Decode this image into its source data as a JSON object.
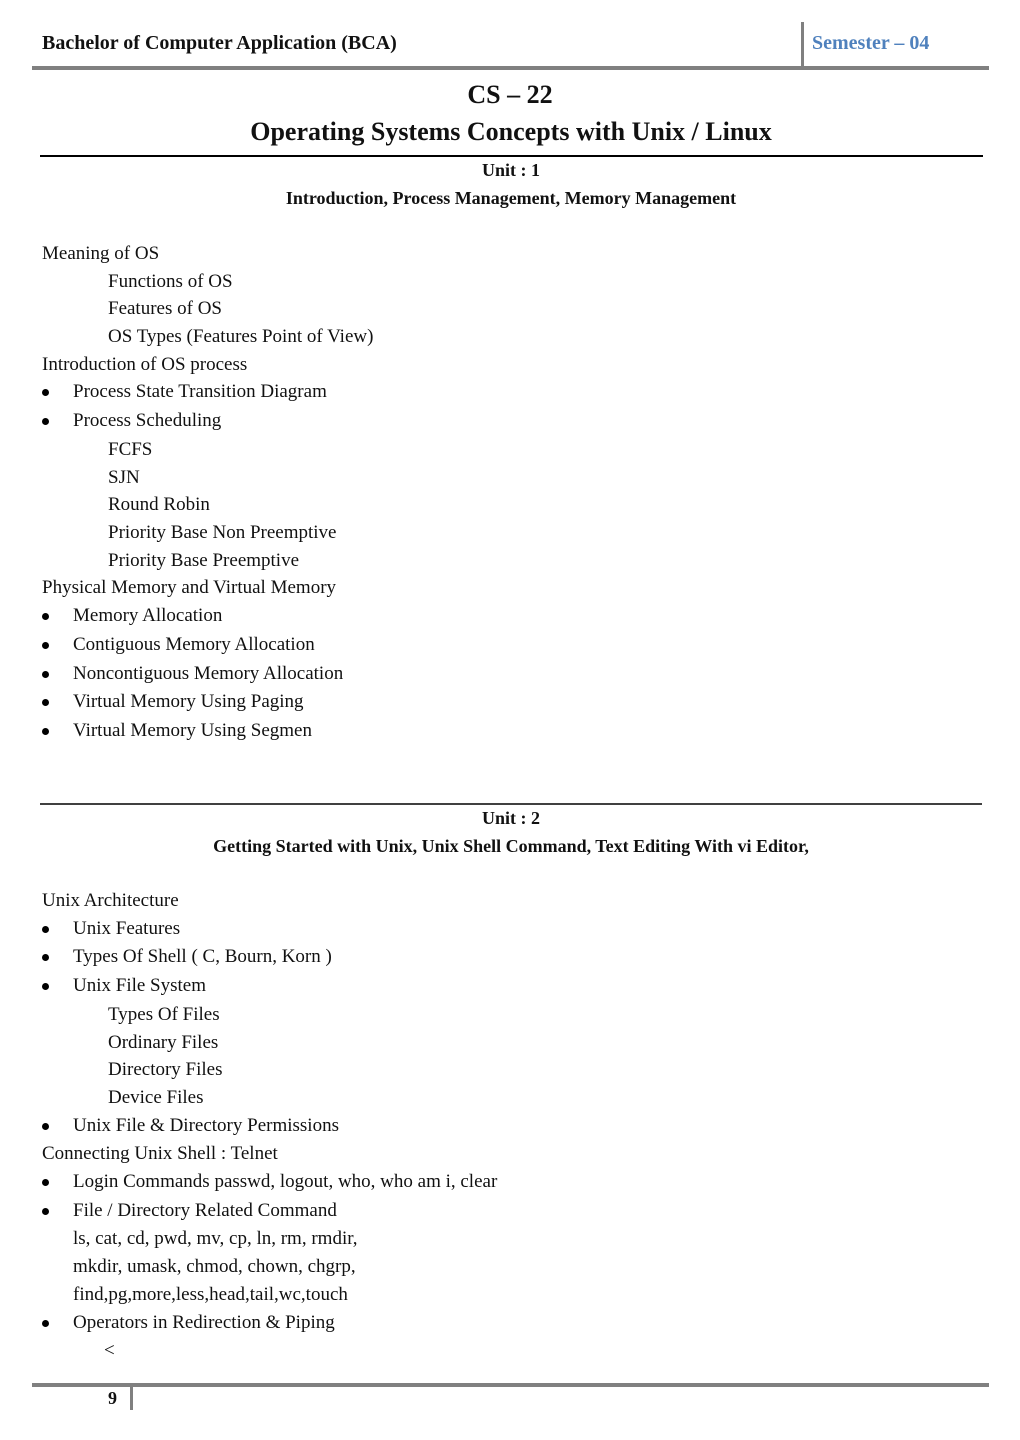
{
  "header": {
    "program": "Bachelor of Computer Application (BCA)",
    "semester": "Semester – 04",
    "semester_color": "#4f81bd"
  },
  "course": {
    "code": "CS – 22",
    "title": "Operating Systems Concepts with Unix / Linux"
  },
  "units": [
    {
      "label": "Unit : 1",
      "subtitle": "Introduction, Process Management, Memory Management",
      "lines": [
        {
          "type": "plain",
          "text": "Meaning of OS"
        },
        {
          "type": "sub",
          "text": "Functions of OS"
        },
        {
          "type": "sub",
          "text": "Features of OS"
        },
        {
          "type": "sub",
          "text": "OS Types (Features Point of View)"
        },
        {
          "type": "plain",
          "text": "Introduction of OS process"
        },
        {
          "type": "bullet",
          "text": "Process State Transition Diagram"
        },
        {
          "type": "bullet",
          "text": "Process Scheduling"
        },
        {
          "type": "sub",
          "text": "FCFS"
        },
        {
          "type": "sub",
          "text": "SJN"
        },
        {
          "type": "sub",
          "text": "Round Robin"
        },
        {
          "type": "sub",
          "text": "Priority Base Non Preemptive"
        },
        {
          "type": "sub",
          "text": "Priority Base Preemptive"
        },
        {
          "type": "plain",
          "text": "Physical Memory and Virtual Memory"
        },
        {
          "type": "bullet",
          "text": "Memory Allocation"
        },
        {
          "type": "bullet",
          "text": "Contiguous Memory Allocation"
        },
        {
          "type": "bullet",
          "text": "Noncontiguous Memory Allocation"
        },
        {
          "type": "bullet",
          "text": "Virtual Memory Using Paging"
        },
        {
          "type": "bullet",
          "text": "Virtual Memory Using Segmen"
        }
      ]
    },
    {
      "label": "Unit : 2",
      "subtitle": "Getting Started with Unix, Unix Shell Command, Text Editing With vi Editor,",
      "lines": [
        {
          "type": "plain",
          "text": "Unix Architecture"
        },
        {
          "type": "bullet",
          "text": "Unix Features"
        },
        {
          "type": "bullet",
          "text": "Types Of Shell ( C, Bourn, Korn )"
        },
        {
          "type": "bullet",
          "text": "Unix File System"
        },
        {
          "type": "sub",
          "text": "Types Of Files"
        },
        {
          "type": "sub",
          "text": "Ordinary Files"
        },
        {
          "type": "sub",
          "text": "Directory Files"
        },
        {
          "type": "sub",
          "text": "Device Files"
        },
        {
          "type": "bullet",
          "text": "Unix File & Directory Permissions"
        },
        {
          "type": "plain",
          "text": "Connecting Unix Shell : Telnet"
        },
        {
          "type": "bullet",
          "text": "Login Commands passwd, logout, who, who am i, clear"
        },
        {
          "type": "bullet",
          "text": "File / Directory Related Command"
        },
        {
          "type": "cont",
          "text": "ls, cat, cd, pwd, mv, cp, ln, rm, rmdir,"
        },
        {
          "type": "cont",
          "text": "mkdir, umask, chmod, chown, chgrp,"
        },
        {
          "type": "cont",
          "text": "find,pg,more,less,head,tail,wc,touch"
        },
        {
          "type": "bullet",
          "text": "Operators in Redirection & Piping"
        },
        {
          "type": "symbol",
          "text": "<"
        }
      ]
    }
  ],
  "footer": {
    "page_number": "9"
  }
}
